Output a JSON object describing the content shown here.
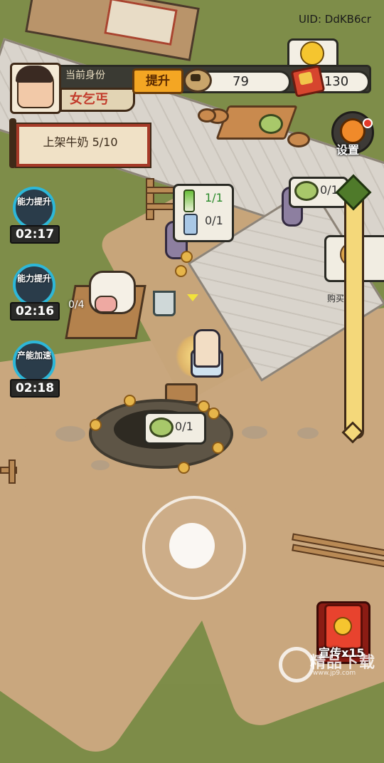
{
  "header": {
    "uid": "UID: DdKB6cr"
  },
  "profile": {
    "identity_label": "当前身份",
    "identity": "女乞丐",
    "upgrade_label": "提升"
  },
  "resources": {
    "coins": "79",
    "tickets": "130"
  },
  "settings": {
    "label": "设置"
  },
  "quest": {
    "text": "上架牛奶 5/10"
  },
  "skills": [
    {
      "label": "能力提升",
      "timer": "02:17",
      "icon": "hammer-icon"
    },
    {
      "label": "能力提升",
      "timer": "02:16",
      "icon": "broom-icon"
    },
    {
      "label": "产能加速",
      "timer": "02:18",
      "icon": "speed-icon"
    }
  ],
  "bubbles": {
    "leek_count": "1/1",
    "bottle_count": "0/1",
    "dish_right_count": "0/1",
    "well_dish_count": "0/1",
    "cow_pen_count": "0/4"
  },
  "side_panel": {
    "label": "购买"
  },
  "promo": {
    "label": "宣传x15"
  },
  "watermark": {
    "text": "精品下载",
    "url": "www.jp9.com"
  },
  "colors": {
    "grass": "#7e8d49",
    "dirt": "#c9a77e",
    "accent_orange": "#f4a623",
    "quest_border": "#a63a28",
    "skill_ring": "#2db7d8"
  }
}
